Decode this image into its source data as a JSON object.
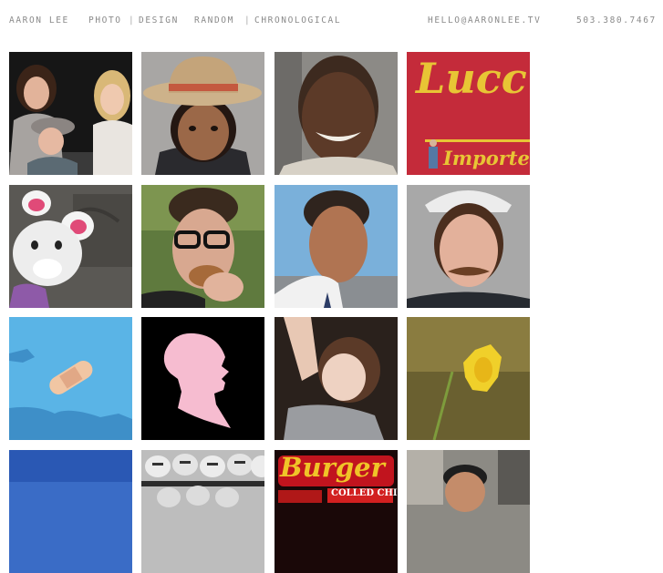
{
  "nav": {
    "name": "aaron lee",
    "photo": "photo",
    "sep1": "|",
    "design": "design",
    "random": "random",
    "sep2": "|",
    "chronological": "chronological",
    "email": "hello@aaronlee.tv",
    "phone": "503.380.7467"
  },
  "tiles": {
    "lucca_text": "Lucc",
    "imported_text": "Imported",
    "burger_text": "Burger",
    "chicken_text": "COLLED CHICKE"
  },
  "colors": {
    "nav_text": "#8a8a8a",
    "sign_red": "#c42b3a",
    "sign_yellow": "#e8c535",
    "map_blue": "#5ab4e6",
    "silhouette_pink": "#f6bcd0"
  }
}
